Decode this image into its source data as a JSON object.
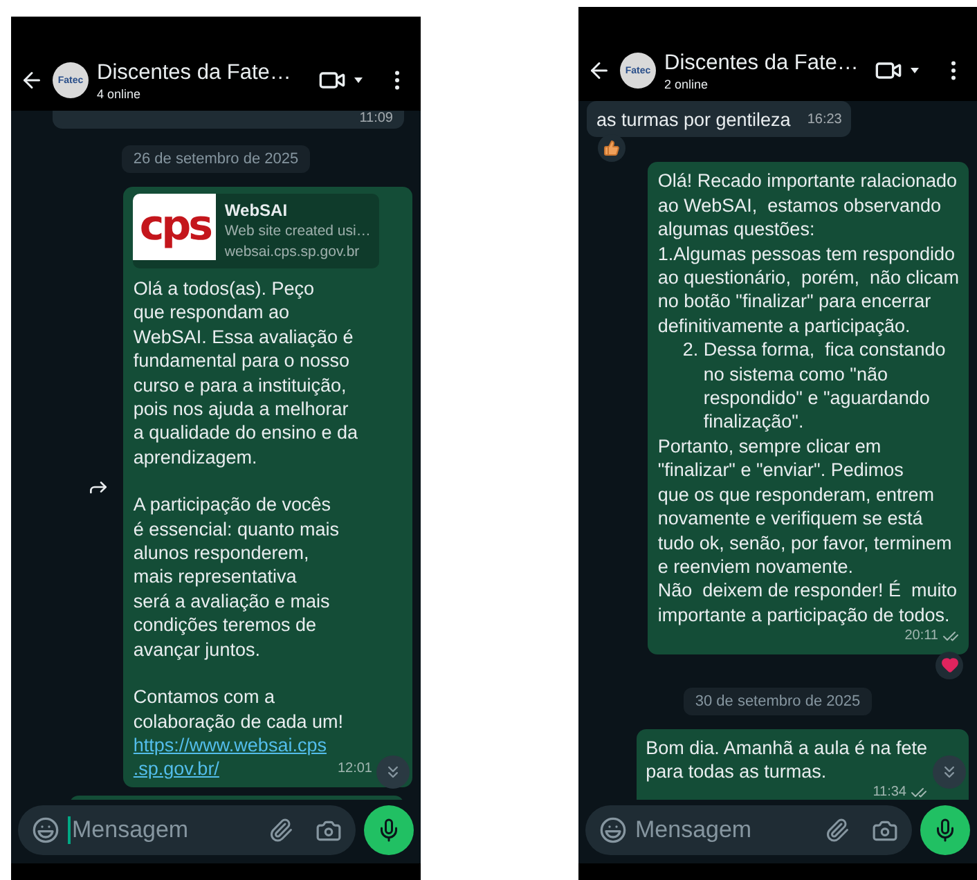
{
  "phones": [
    {
      "header": {
        "avatar_text": "Fatec",
        "title": "Discentes da Fate…",
        "subtitle": "4 online"
      },
      "items": [
        {
          "kind": "stub_top",
          "outgoing": false,
          "time": "11:09"
        },
        {
          "kind": "date",
          "text": "26 de setembro de 2025"
        },
        {
          "kind": "message",
          "outgoing": true,
          "forwarded": true,
          "preview": {
            "logo_text": "cps",
            "title": "WebSAI",
            "description": "Web site created usi…",
            "domain": "websai.cps.sp.gov.br"
          },
          "blocks": [
            {
              "text": "Olá a todos(as). Peço\nque respondam ao\nWebSAI. Essa avaliação é\nfundamental para o nosso\ncurso e para a instituição,\npois nos ajuda a melhorar\na qualidade do ensino e da\naprendizagem.",
              "indent": false
            },
            {
              "text": "A participação de vocês\né essencial: quanto mais\nalunos responderem,\nmais representativa\nserá a avaliação e mais\ncondições teremos de\navançar juntos.",
              "indent": false
            },
            {
              "text": "Contamos com a\ncolaboração de cada um!",
              "indent": false
            }
          ],
          "link": "https://www.websai.cps\n.sp.gov.br/",
          "time": "12:01"
        },
        {
          "kind": "stub_bottom",
          "outgoing": true
        }
      ],
      "composer": {
        "placeholder": "Mensagem",
        "focused": true
      }
    },
    {
      "header": {
        "avatar_text": "Fatec",
        "title": "Discentes da Fate…",
        "subtitle": "2 online"
      },
      "items": [
        {
          "kind": "message",
          "outgoing": false,
          "blocks": [
            {
              "text": "as turmas por gentileza",
              "indent": false
            }
          ],
          "time": "16:23",
          "reaction": {
            "kind": "thumbs_up"
          }
        },
        {
          "kind": "message",
          "outgoing": true,
          "blocks": [
            {
              "text": "Olá! Recado importante ralacionado\nao WebSAI,  estamos observando\nalgumas questões:\n1.Algumas pessoas tem respondido\nao questionário,  porém,  não clicam\nno botão \"finalizar\" para encerrar\ndefinitivamente a participação.",
              "indent": false
            },
            {
              "text": "2. Dessa forma,  fica constando\n    no sistema como \"não\n    respondido\" e \"aguardando\n    finalização\".",
              "indent": true
            },
            {
              "text": "Portanto, sempre clicar em\n\"finalizar\" e \"enviar\". Pedimos\nque os que responderam, entrem\nnovamente e verifiquem se está\ntudo ok, senão, por favor, terminem\ne reenviem novamente.\nNão  deixem de responder! É  muito\nimportante a participação de todos.",
              "indent": false
            }
          ],
          "time": "20:11",
          "double_tick": true,
          "reaction": {
            "kind": "heart"
          }
        },
        {
          "kind": "date",
          "text": "30 de setembro de 2025"
        },
        {
          "kind": "message",
          "outgoing": true,
          "blocks": [
            {
              "text": "Bom dia. Amanhã a aula é na fete\npara todas as turmas.",
              "indent": false
            }
          ],
          "time": "11:34",
          "double_tick": true
        }
      ],
      "composer": {
        "placeholder": "Mensagem",
        "focused": false
      }
    }
  ]
}
